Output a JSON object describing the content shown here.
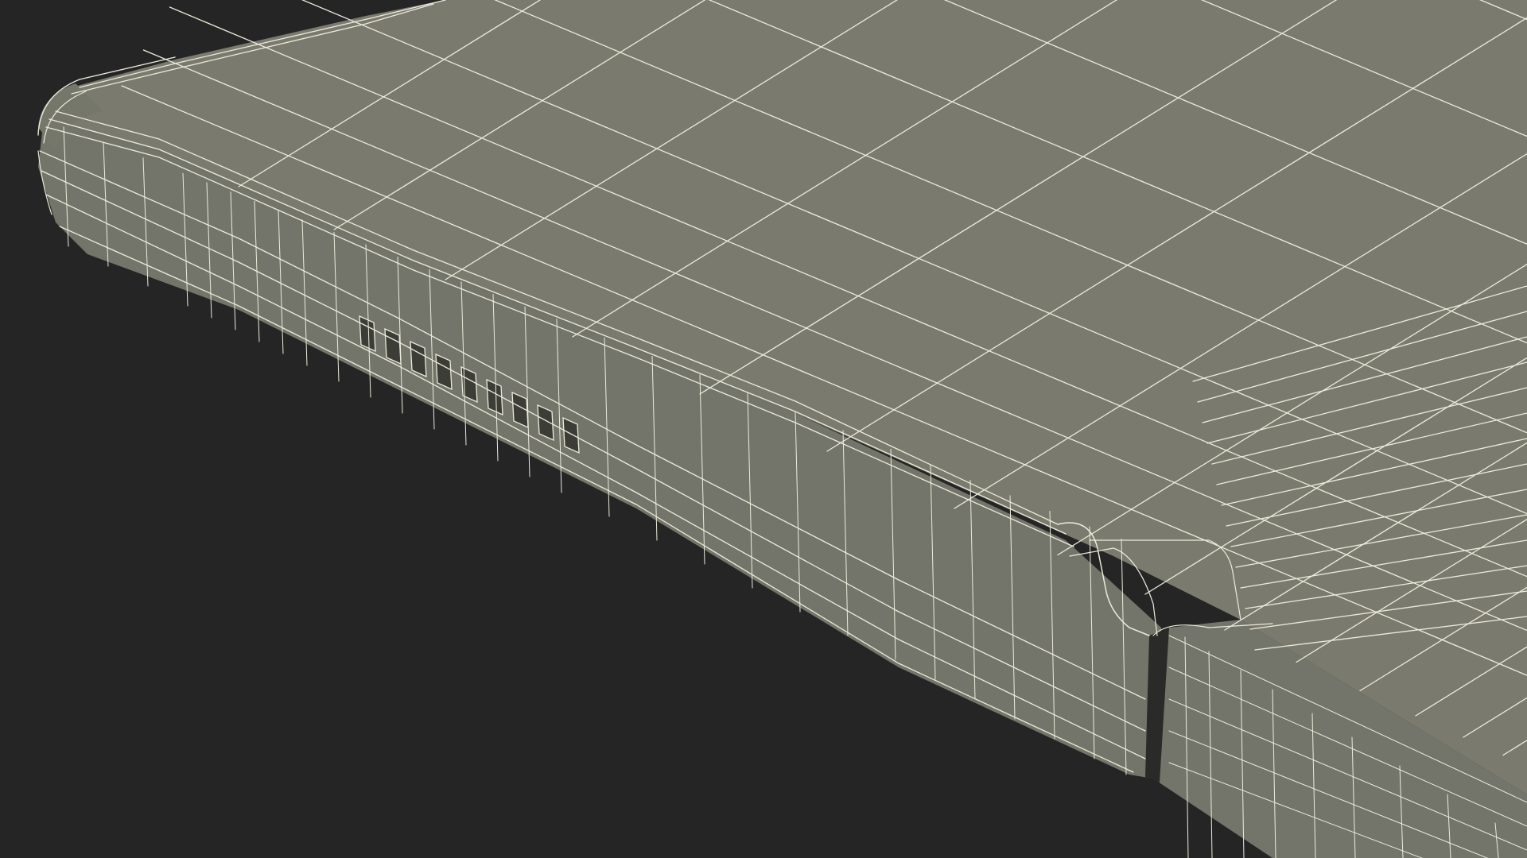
{
  "scene": {
    "subject": "wireframe-render-foldable-phone-bottom-edge",
    "colors": {
      "background": "#252525",
      "surface": "#7a7b6e",
      "surface_side": "#74756a",
      "surface_dark": "#6a6b60",
      "hole": "#3d3d38",
      "wire": "#ecebdc"
    }
  }
}
